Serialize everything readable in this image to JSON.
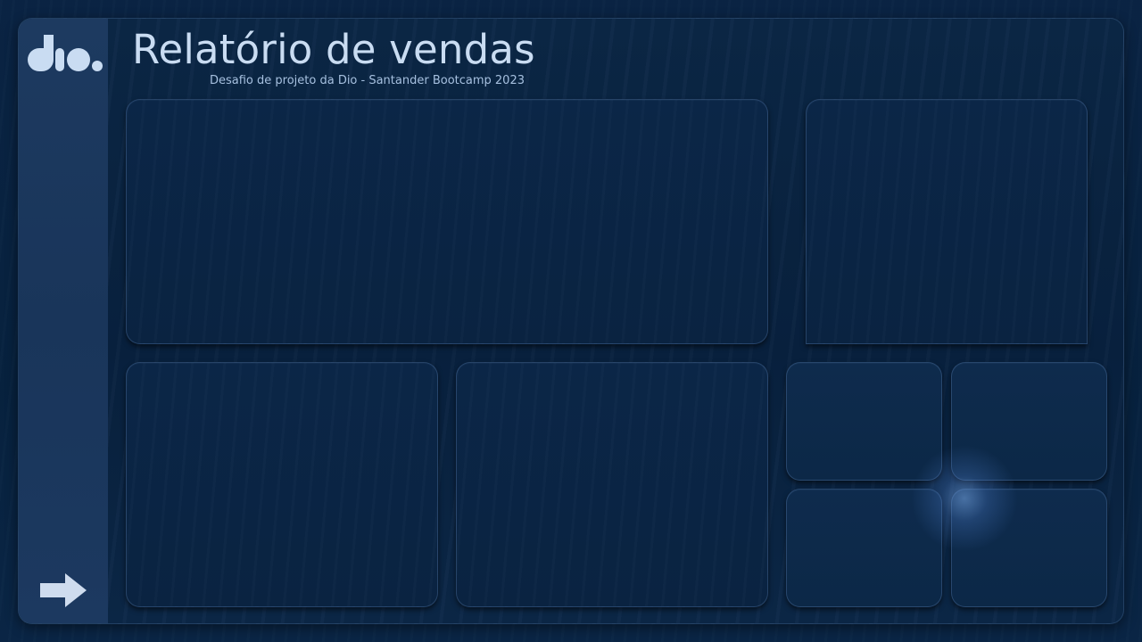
{
  "report": {
    "title": "Relatório de vendas",
    "subtitle": "Desafio de projeto da Dio - Santander Bootcamp 2023"
  },
  "sidebar": {
    "logo_text": "dio.",
    "logo_icon": "dio-logo",
    "nav_icon": "arrow-right-icon"
  },
  "colors": {
    "background": "#082340",
    "sidebar": "#1c3960",
    "title": "#c9dcf2",
    "subtitle": "#a6c0df",
    "panel_border": "#3d5f8c"
  }
}
